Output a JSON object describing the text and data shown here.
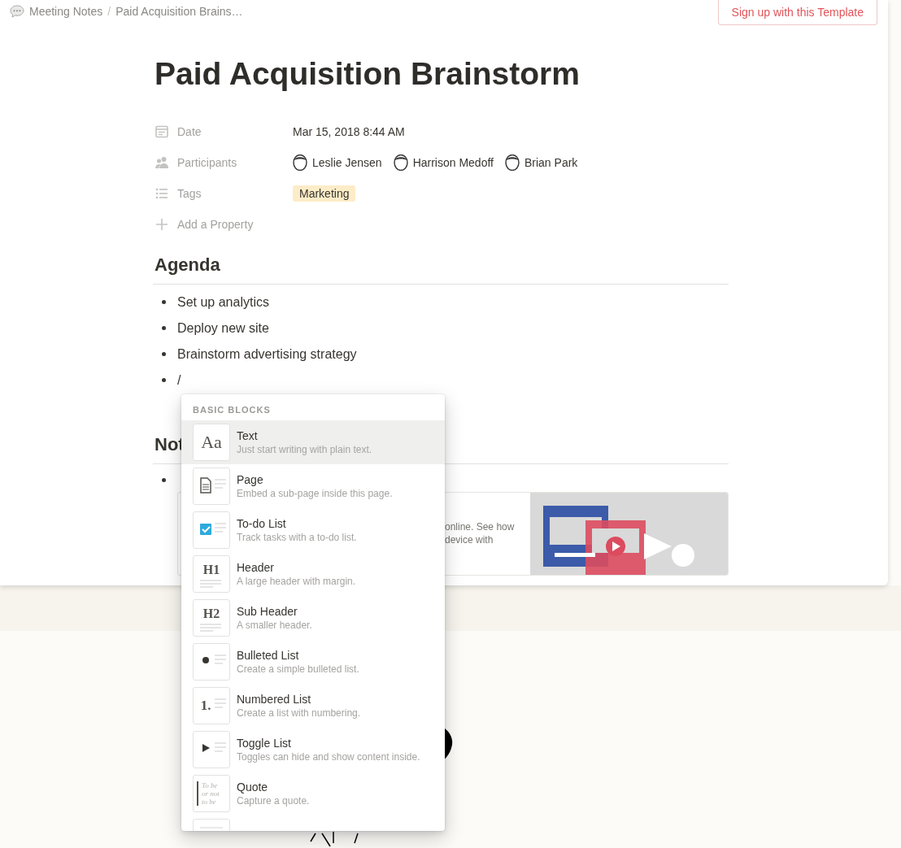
{
  "breadcrumb": [
    {
      "text": "Meeting Notes"
    },
    {
      "text": "Paid Acquisition Brains…"
    }
  ],
  "breadcrumb_separator": "/",
  "signup_button": "Sign up with this Template",
  "title": "Paid Acquisition Brainstorm",
  "properties": [
    {
      "kind": "date",
      "label": "Date",
      "value": "Mar 15, 2018 8:44 AM"
    },
    {
      "kind": "people",
      "label": "Participants",
      "people": [
        "Leslie Jensen",
        "Harrison Medoff",
        "Brian Park"
      ]
    },
    {
      "kind": "tags",
      "label": "Tags",
      "tags": [
        "Marketing"
      ]
    },
    {
      "kind": "add",
      "label": "Add a Property"
    }
  ],
  "sections": [
    {
      "heading": "Agenda",
      "bullets": [
        "Set up analytics",
        "Deploy new site",
        "Brainstorm advertising strategy",
        "/"
      ]
    },
    {
      "heading": "Not",
      "embed": {
        "lines": [
          "online. See how",
          "device with"
        ],
        "image": {
          "kind": "picture"
        }
      }
    }
  ],
  "menu": {
    "header": "BASIC BLOCKS",
    "items": [
      {
        "kind": "text",
        "glyph": "Aa",
        "title": "Text",
        "description": "Just start writing with plain text.",
        "selected": true
      },
      {
        "kind": "page",
        "title": "Page",
        "description": "Embed a sub-page inside this page.",
        "selected": false
      },
      {
        "kind": "todo",
        "title": "To-do List",
        "description": "Track tasks with a to-do list.",
        "selected": false
      },
      {
        "kind": "header",
        "glyph": "H1",
        "title": "Header",
        "description": "A large header with margin.",
        "selected": false
      },
      {
        "kind": "header",
        "glyph": "H2",
        "title": "Sub Header",
        "description": "A smaller header.",
        "selected": false
      },
      {
        "kind": "bulleted",
        "title": "Bulleted List",
        "description": "Create a simple bulleted list.",
        "selected": false
      },
      {
        "kind": "numbered",
        "glyph": "1.",
        "title": "Numbered List",
        "description": "Create a list with numbering.",
        "selected": false
      },
      {
        "kind": "toggle",
        "title": "Toggle List",
        "description": "Toggles can hide and show content inside.",
        "selected": false
      },
      {
        "kind": "quote",
        "glyph": "To be or not to be",
        "title": "Quote",
        "description": "Capture a quote.",
        "selected": false
      },
      {
        "kind": "divider",
        "selected": false
      }
    ]
  }
}
